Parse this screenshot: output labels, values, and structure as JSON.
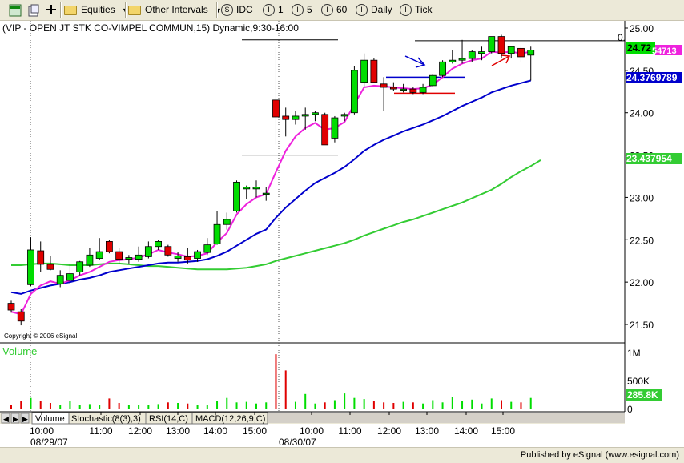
{
  "toolbar": {
    "equities_label": "Equities",
    "intervals_label": "Other Intervals",
    "idc_label": "IDC",
    "int1_label": "1",
    "int5_label": "5",
    "int60_label": "60",
    "daily_label": "Daily",
    "tick_label": "Tick"
  },
  "chart_title": "(VIP - OPEN JT STK CO-VIMPEL COMMUN,15) Dynamic,9:30-16:00",
  "copyright": "Copyright © 2006 eSignal.",
  "corner_value": "0.",
  "volume_label": "Volume",
  "price_readouts": {
    "last": "24.72",
    "last_suffix": "54713",
    "ma_blue": "24.3769789",
    "ma_green": "23.437954"
  },
  "volume_readout": "285.8K",
  "tabs": [
    "Volume",
    "Stochastic(8(3),3)",
    "RSI(14,C)",
    "MACD(12,26,9,C)"
  ],
  "dates": [
    "08/29/07",
    "08/30/07"
  ],
  "publisher": "Published by eSignal (www.esignal.com)",
  "colors": {
    "up": "#00dd00",
    "down": "#e00000",
    "ma_magenta": "#ee22dd",
    "ma_blue": "#0000cc",
    "ma_green": "#33cc33"
  },
  "chart_data": {
    "type": "candlestick",
    "interval": "15 min",
    "ylim": [
      21.3,
      25.05
    ],
    "y_ticks": [
      "25.00",
      "24.50",
      "24.00",
      "23.50",
      "23.00",
      "22.50",
      "22.00",
      "21.50"
    ],
    "x_ticks": [
      "10:00",
      "11:00",
      "12:00",
      "13:00",
      "14:00",
      "15:00",
      "10:00",
      "11:00",
      "12:00",
      "13:00",
      "14:00",
      "15:00"
    ],
    "volume_ticks": [
      "1M",
      "500K",
      "0"
    ],
    "volume_ylim": [
      0,
      1000
    ],
    "candles": [
      {
        "o": 21.75,
        "h": 21.78,
        "l": 21.64,
        "c": 21.67,
        "v": 60
      },
      {
        "o": 21.65,
        "h": 21.68,
        "l": 21.49,
        "c": 21.54,
        "v": 130
      },
      {
        "o": 21.97,
        "h": 22.53,
        "l": 21.95,
        "c": 22.38,
        "v": 190
      },
      {
        "o": 22.37,
        "h": 22.48,
        "l": 22.12,
        "c": 22.21,
        "v": 140
      },
      {
        "o": 22.21,
        "h": 22.31,
        "l": 22.14,
        "c": 22.15,
        "v": 100
      },
      {
        "o": 21.98,
        "h": 22.14,
        "l": 21.94,
        "c": 22.08,
        "v": 60
      },
      {
        "o": 22.02,
        "h": 22.22,
        "l": 21.98,
        "c": 22.1,
        "v": 130
      },
      {
        "o": 22.12,
        "h": 22.25,
        "l": 22.08,
        "c": 22.24,
        "v": 70
      },
      {
        "o": 22.2,
        "h": 22.4,
        "l": 22.18,
        "c": 22.32,
        "v": 80
      },
      {
        "o": 22.28,
        "h": 22.52,
        "l": 22.26,
        "c": 22.36,
        "v": 60
      },
      {
        "o": 22.48,
        "h": 22.5,
        "l": 22.34,
        "c": 22.36,
        "v": 180
      },
      {
        "o": 22.36,
        "h": 22.4,
        "l": 22.22,
        "c": 22.27,
        "v": 100
      },
      {
        "o": 22.27,
        "h": 22.32,
        "l": 22.22,
        "c": 22.29,
        "v": 70
      },
      {
        "o": 22.27,
        "h": 22.42,
        "l": 22.24,
        "c": 22.32,
        "v": 60
      },
      {
        "o": 22.3,
        "h": 22.48,
        "l": 22.28,
        "c": 22.42,
        "v": 60
      },
      {
        "o": 22.42,
        "h": 22.5,
        "l": 22.38,
        "c": 22.48,
        "v": 80
      },
      {
        "o": 22.42,
        "h": 22.44,
        "l": 22.3,
        "c": 22.32,
        "v": 110
      },
      {
        "o": 22.28,
        "h": 22.36,
        "l": 22.24,
        "c": 22.31,
        "v": 100
      },
      {
        "o": 22.3,
        "h": 22.4,
        "l": 22.22,
        "c": 22.26,
        "v": 90
      },
      {
        "o": 22.28,
        "h": 22.38,
        "l": 22.24,
        "c": 22.36,
        "v": 60
      },
      {
        "o": 22.35,
        "h": 22.52,
        "l": 22.32,
        "c": 22.44,
        "v": 60
      },
      {
        "o": 22.45,
        "h": 22.84,
        "l": 22.44,
        "c": 22.68,
        "v": 130
      },
      {
        "o": 22.68,
        "h": 22.82,
        "l": 22.62,
        "c": 22.74,
        "v": 190
      },
      {
        "o": 22.84,
        "h": 23.2,
        "l": 22.82,
        "c": 23.18,
        "v": 110
      },
      {
        "o": 23.1,
        "h": 23.14,
        "l": 22.98,
        "c": 23.12,
        "v": 120
      },
      {
        "o": 23.1,
        "h": 23.2,
        "l": 23.0,
        "c": 23.12,
        "v": 90
      },
      {
        "o": 23.05,
        "h": 23.12,
        "l": 22.96,
        "c": 23.05,
        "v": 110
      },
      {
        "o": 24.15,
        "h": 24.78,
        "l": 23.62,
        "c": 23.95,
        "v": 970
      },
      {
        "o": 23.96,
        "h": 24.06,
        "l": 23.72,
        "c": 23.92,
        "v": 680
      },
      {
        "o": 23.92,
        "h": 24.02,
        "l": 23.86,
        "c": 23.96,
        "v": 120
      },
      {
        "o": 23.96,
        "h": 24.06,
        "l": 23.8,
        "c": 23.98,
        "v": 260
      },
      {
        "o": 23.98,
        "h": 24.02,
        "l": 23.9,
        "c": 24.0,
        "v": 90
      },
      {
        "o": 23.98,
        "h": 24.0,
        "l": 23.62,
        "c": 23.62,
        "v": 110
      },
      {
        "o": 23.7,
        "h": 23.96,
        "l": 23.65,
        "c": 23.94,
        "v": 150
      },
      {
        "o": 23.96,
        "h": 24.0,
        "l": 23.9,
        "c": 23.98,
        "v": 270
      },
      {
        "o": 24.0,
        "h": 24.55,
        "l": 23.98,
        "c": 24.5,
        "v": 190
      },
      {
        "o": 24.36,
        "h": 24.7,
        "l": 24.3,
        "c": 24.62,
        "v": 170
      },
      {
        "o": 24.62,
        "h": 24.64,
        "l": 24.35,
        "c": 24.36,
        "v": 130
      },
      {
        "o": 24.34,
        "h": 24.42,
        "l": 24.02,
        "c": 24.3,
        "v": 110
      },
      {
        "o": 24.3,
        "h": 24.36,
        "l": 24.26,
        "c": 24.28,
        "v": 100
      },
      {
        "o": 24.28,
        "h": 24.34,
        "l": 24.24,
        "c": 24.28,
        "v": 120
      },
      {
        "o": 24.28,
        "h": 24.3,
        "l": 24.22,
        "c": 24.24,
        "v": 110
      },
      {
        "o": 24.24,
        "h": 24.34,
        "l": 24.22,
        "c": 24.3,
        "v": 90
      },
      {
        "o": 24.32,
        "h": 24.46,
        "l": 24.3,
        "c": 24.44,
        "v": 150
      },
      {
        "o": 24.44,
        "h": 24.62,
        "l": 24.42,
        "c": 24.6,
        "v": 110
      },
      {
        "o": 24.6,
        "h": 24.74,
        "l": 24.58,
        "c": 24.62,
        "v": 200
      },
      {
        "o": 24.62,
        "h": 24.86,
        "l": 24.58,
        "c": 24.64,
        "v": 130
      },
      {
        "o": 24.64,
        "h": 24.74,
        "l": 24.6,
        "c": 24.72,
        "v": 160
      },
      {
        "o": 24.7,
        "h": 24.78,
        "l": 24.62,
        "c": 24.72,
        "v": 90
      },
      {
        "o": 24.72,
        "h": 24.9,
        "l": 24.7,
        "c": 24.9,
        "v": 180
      },
      {
        "o": 24.9,
        "h": 24.92,
        "l": 24.64,
        "c": 24.7,
        "v": 150
      },
      {
        "o": 24.7,
        "h": 24.78,
        "l": 24.64,
        "c": 24.78,
        "v": 120
      },
      {
        "o": 24.76,
        "h": 24.8,
        "l": 24.6,
        "c": 24.66,
        "v": 110
      },
      {
        "o": 24.68,
        "h": 24.78,
        "l": 24.38,
        "c": 24.74,
        "v": 190
      }
    ],
    "ma_magenta": [
      21.65,
      21.62,
      21.86,
      21.96,
      22.01,
      21.98,
      22.02,
      22.08,
      22.12,
      22.18,
      22.24,
      22.26,
      22.27,
      22.29,
      22.33,
      22.38,
      22.35,
      22.33,
      22.3,
      22.31,
      22.34,
      22.47,
      22.58,
      22.8,
      22.92,
      23.0,
      23.04,
      23.3,
      23.55,
      23.72,
      23.82,
      23.88,
      23.8,
      23.82,
      23.89,
      24.1,
      24.3,
      24.32,
      24.31,
      24.3,
      24.29,
      24.28,
      24.29,
      24.33,
      24.42,
      24.52,
      24.58,
      24.62,
      24.64,
      24.72,
      24.71,
      24.72,
      24.7,
      24.72
    ],
    "ma_blue": [
      21.88,
      21.86,
      21.9,
      21.93,
      21.96,
      21.98,
      22.0,
      22.03,
      22.05,
      22.08,
      22.12,
      22.14,
      22.16,
      22.18,
      22.2,
      22.22,
      22.23,
      22.23,
      22.24,
      22.25,
      22.27,
      22.31,
      22.36,
      22.43,
      22.5,
      22.57,
      22.62,
      22.76,
      22.88,
      22.98,
      23.08,
      23.17,
      23.23,
      23.29,
      23.36,
      23.45,
      23.55,
      23.62,
      23.68,
      23.73,
      23.78,
      23.82,
      23.86,
      23.91,
      23.96,
      24.02,
      24.08,
      24.13,
      24.18,
      24.24,
      24.28,
      24.32,
      24.35,
      24.38
    ],
    "ma_green": [
      22.2,
      22.2,
      22.21,
      22.22,
      22.22,
      22.21,
      22.2,
      22.2,
      22.2,
      22.21,
      22.22,
      22.22,
      22.21,
      22.2,
      22.19,
      22.19,
      22.18,
      22.17,
      22.16,
      22.15,
      22.15,
      22.15,
      22.15,
      22.16,
      22.17,
      22.19,
      22.21,
      22.25,
      22.28,
      22.31,
      22.34,
      22.37,
      22.4,
      22.43,
      22.46,
      22.5,
      22.55,
      22.59,
      22.63,
      22.67,
      22.71,
      22.74,
      22.78,
      22.82,
      22.86,
      22.9,
      22.94,
      22.99,
      23.04,
      23.09,
      23.16,
      23.24,
      23.31,
      23.37,
      23.44
    ]
  }
}
